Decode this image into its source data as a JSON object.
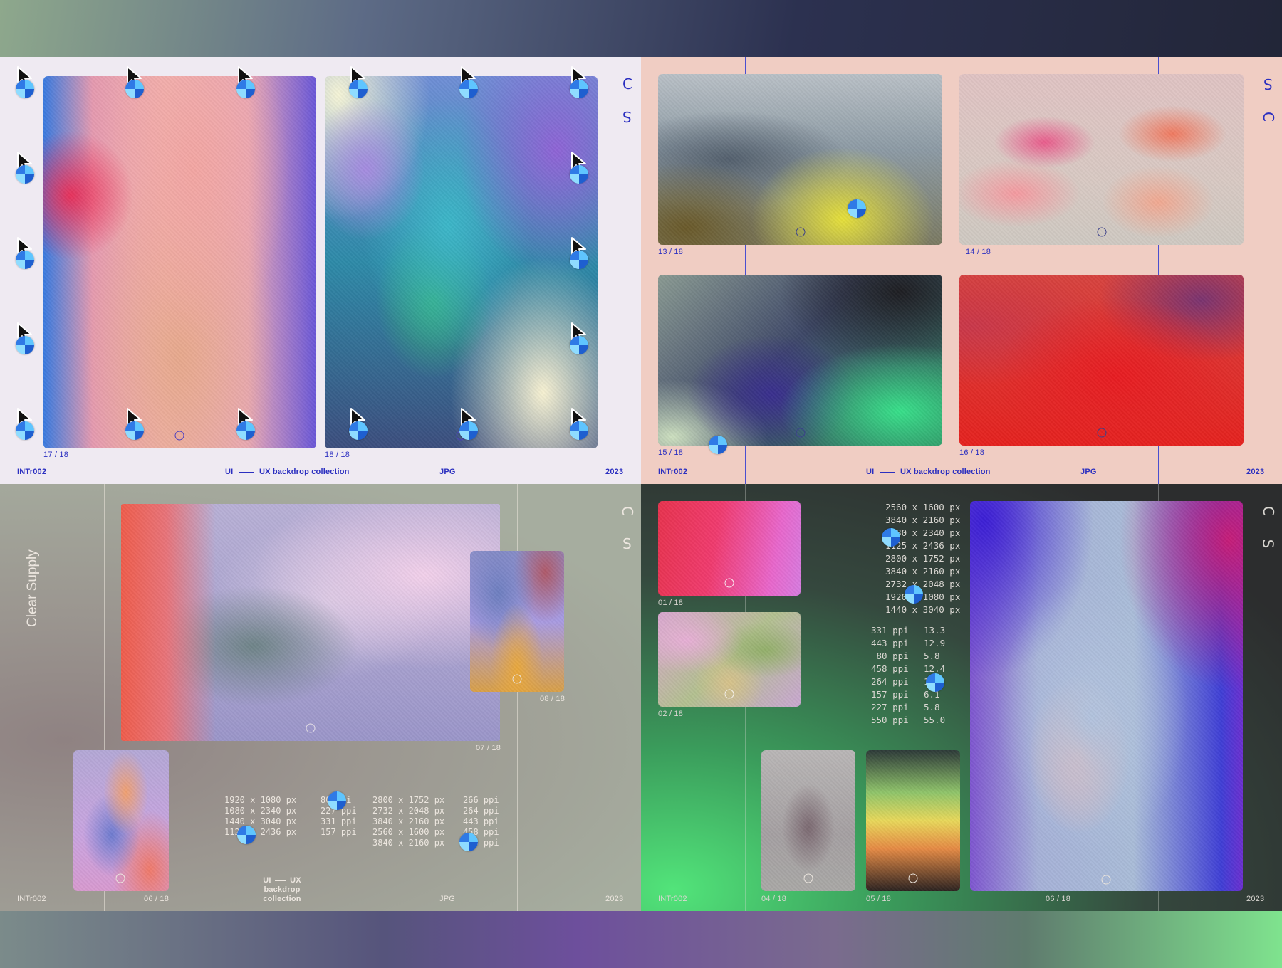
{
  "colors": {
    "blue_text": "#2b2fc0",
    "light_text": "#e8e3dd",
    "dark_panel_text": "#d9d6d1"
  },
  "icons": {
    "cursor": "arrow-cursor-icon",
    "wheel": "spinning-wheel-icon",
    "ring": "circle-marker-icon"
  },
  "panel1": {
    "card1_label": "17 / 18",
    "card2_label": "18 / 18",
    "footer": {
      "code": "INTr002",
      "ui": "UI",
      "title": "UX backdrop collection",
      "format": "JPG",
      "year": "2023"
    },
    "glyphs": [
      "C",
      "S"
    ]
  },
  "panel2": {
    "labels": [
      "13 / 18",
      "14 / 18",
      "15 / 18",
      "16 / 18"
    ],
    "footer": {
      "code": "INTr002",
      "ui": "UI",
      "title": "UX backdrop collection",
      "format": "JPG",
      "year": "2023"
    },
    "glyphs": [
      "S",
      "C"
    ]
  },
  "panel3": {
    "brand": "Clear Supply",
    "labels": [
      "07 / 18",
      "08 / 18",
      "06 / 18"
    ],
    "spec_col1": "1920 x 1080 px\n1080 x 2340 px\n1440 x 3040 px\n1125 x 2436 px",
    "spec_col2": "80 ppi\n227 ppi\n331 ppi\n157 ppi",
    "spec_col3": "2800 x 1752 px\n2732 x 2048 px\n3840 x 2160 px\n2560 x 1600 px\n3840 x 2160 px",
    "spec_col4": "266 ppi\n264 ppi\n443 ppi\n458 ppi\n458 ppi",
    "footer": {
      "code": "INTr002",
      "ui": "UI",
      "title": "UX backdrop collection",
      "format": "JPG",
      "year": "2023"
    },
    "glyphs": [
      "C",
      "S"
    ]
  },
  "panel4": {
    "labels": [
      "01 / 18",
      "02 / 18",
      "04 / 18",
      "05 / 18",
      "06 / 18"
    ],
    "res_list": "2560 x 1600 px\n3840 x 2160 px\n1080 x 2340 px\n1125 x 2436 px\n2800 x 1752 px\n3840 x 2160 px\n2732 x 2048 px\n1920 x 1080 px\n1440 x 3040 px",
    "ppi_list": "331 ppi\n443 ppi\n 80 ppi\n458 ppi\n264 ppi\n157 ppi\n227 ppi\n550 ppi",
    "size_list": "13.3\n12.9\n5.8\n12.4\n11\n6.1\n5.8\n55.0",
    "footer": {
      "code": "INTr002",
      "year": "2023"
    },
    "glyphs": [
      "C",
      "S"
    ]
  }
}
